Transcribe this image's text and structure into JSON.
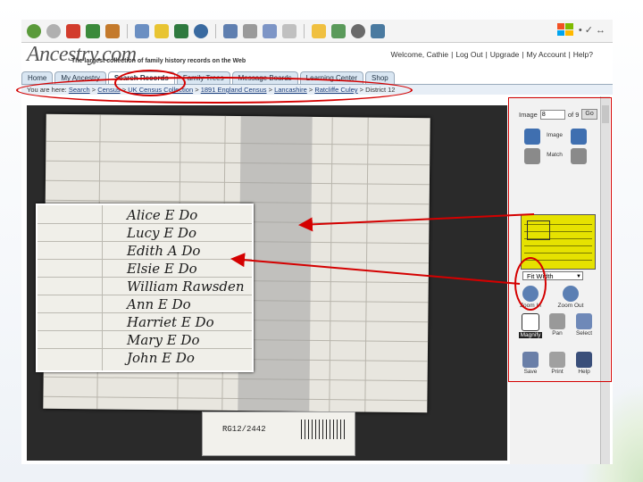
{
  "browser_toolbar": {
    "icons": [
      "back-icon",
      "forward-icon",
      "stop-icon",
      "refresh-icon",
      "home-icon",
      "search-icon",
      "favorites-icon",
      "media-icon",
      "history-icon",
      "mail-icon",
      "print-icon",
      "edit-icon",
      "discuss-icon",
      "folder-icon",
      "messenger-icon",
      "research-icon"
    ],
    "right_glyphs": "• ✓ ↔"
  },
  "header": {
    "logo": "Ancestry.com",
    "tagline": "The largest collection of family history records on the Web",
    "welcome": "Welcome, Cathie",
    "links": [
      "Log Out",
      "Upgrade",
      "My Account",
      "Help?"
    ]
  },
  "tabs": [
    "Home",
    "My Ancestry",
    "Search Records",
    "Family Trees",
    "Message Boards",
    "Learning Center",
    "Shop"
  ],
  "active_tab": "Search Records",
  "breadcrumb": {
    "prefix": "You are here:",
    "items": [
      "Search",
      "Census",
      "UK Census Collection",
      "1891 England Census",
      "Lancashire",
      "Ratcliffe Culey",
      "District 12"
    ],
    "separator": " > "
  },
  "magnified_text": [
    "Alice  E  Do",
    "Lucy  E  Do",
    "Edith  A  Do",
    "Elsie  E  Do",
    "William  Rawsden",
    "Ann  E  Do",
    "Harriet  E  Do",
    "Mary  E  Do",
    "John  E  Do"
  ],
  "stub": {
    "reference": "RG12/2442"
  },
  "panel": {
    "image_label": "Image",
    "image_number": "8",
    "of_label": "of 9",
    "go_label": "Go",
    "image_button": "Image",
    "match_button": "Match",
    "fit_select": "Fit Width",
    "zoom_in": "Zoom In",
    "zoom_out": "Zoom Out",
    "magnify": "Magnify",
    "pan": "Pan",
    "select": "Select",
    "save": "Save",
    "print": "Print",
    "help": "Help"
  },
  "colors": {
    "annotation": "#d40000",
    "thumbnail": "#e6e200",
    "tab_bg": "#d9e6f2"
  }
}
